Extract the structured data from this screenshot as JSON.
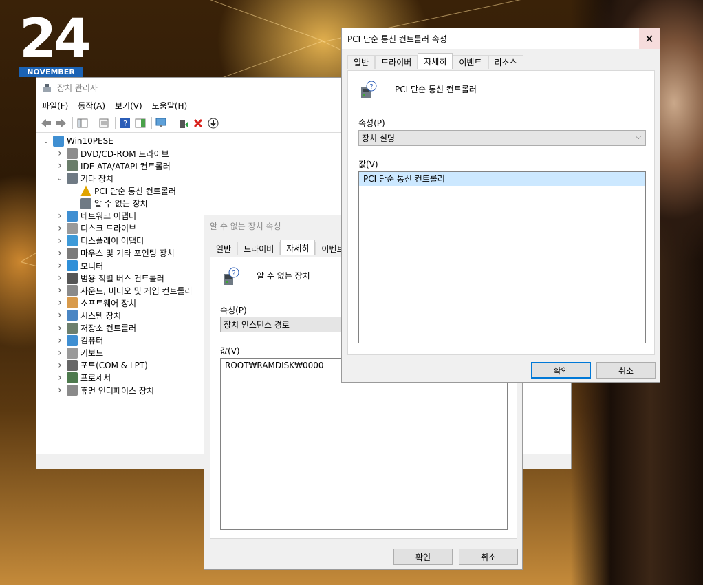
{
  "wallpaper": {
    "date_day": "24",
    "date_month": "NOVEMBER"
  },
  "device_manager": {
    "title": "장치 관리자",
    "menu": [
      "파일(F)",
      "동작(A)",
      "보기(V)",
      "도움말(H)"
    ],
    "tree": [
      {
        "label": "Win10PESE",
        "level": 0,
        "chevron": "v",
        "icon": "computer-icon"
      },
      {
        "label": "DVD/CD-ROM 드라이브",
        "level": 1,
        "chevron": ">",
        "icon": "dvd-drive-icon"
      },
      {
        "label": "IDE ATA/ATAPI 컨트롤러",
        "level": 1,
        "chevron": ">",
        "icon": "ide-controller-icon"
      },
      {
        "label": "기타 장치",
        "level": 1,
        "chevron": "v",
        "icon": "unknown-device-icon"
      },
      {
        "label": "PCI 단순 통신 컨트롤러",
        "level": 2,
        "chevron": "",
        "icon": "warning-device-icon"
      },
      {
        "label": "알 수 없는 장치",
        "level": 2,
        "chevron": "",
        "icon": "unknown-device-icon"
      },
      {
        "label": "네트워크 어댑터",
        "level": 1,
        "chevron": ">",
        "icon": "network-adapter-icon"
      },
      {
        "label": "디스크 드라이브",
        "level": 1,
        "chevron": ">",
        "icon": "disk-drive-icon"
      },
      {
        "label": "디스플레이 어댑터",
        "level": 1,
        "chevron": ">",
        "icon": "display-adapter-icon"
      },
      {
        "label": "마우스 및 기타 포인팅 장치",
        "level": 1,
        "chevron": ">",
        "icon": "mouse-icon"
      },
      {
        "label": "모니터",
        "level": 1,
        "chevron": ">",
        "icon": "monitor-icon"
      },
      {
        "label": "범용 직렬 버스 컨트롤러",
        "level": 1,
        "chevron": ">",
        "icon": "usb-icon"
      },
      {
        "label": "사운드, 비디오 및 게임 컨트롤러",
        "level": 1,
        "chevron": ">",
        "icon": "speaker-icon"
      },
      {
        "label": "소프트웨어 장치",
        "level": 1,
        "chevron": ">",
        "icon": "software-device-icon"
      },
      {
        "label": "시스템 장치",
        "level": 1,
        "chevron": ">",
        "icon": "system-device-icon"
      },
      {
        "label": "저장소 컨트롤러",
        "level": 1,
        "chevron": ">",
        "icon": "storage-controller-icon"
      },
      {
        "label": "컴퓨터",
        "level": 1,
        "chevron": ">",
        "icon": "computer-icon"
      },
      {
        "label": "키보드",
        "level": 1,
        "chevron": ">",
        "icon": "keyboard-icon"
      },
      {
        "label": "포트(COM & LPT)",
        "level": 1,
        "chevron": ">",
        "icon": "port-icon"
      },
      {
        "label": "프로세서",
        "level": 1,
        "chevron": ">",
        "icon": "processor-icon"
      },
      {
        "label": "휴먼 인터페이스 장치",
        "level": 1,
        "chevron": ">",
        "icon": "hid-icon"
      }
    ]
  },
  "unknown_dialog": {
    "title": "알 수 없는 장치 속성",
    "tabs": [
      "일반",
      "드라이버",
      "자세히",
      "이벤트"
    ],
    "active_tab": "자세히",
    "device_name": "알 수 없는 장치",
    "property_label": "속성(P)",
    "property_value": "장치 인스턴스 경로",
    "value_label": "값(V)",
    "values": [
      "ROOT₩RAMDISK₩0000"
    ],
    "ok": "확인",
    "cancel": "취소"
  },
  "pci_dialog": {
    "title": "PCI 단순 통신 컨트롤러 속성",
    "tabs": [
      "일반",
      "드라이버",
      "자세히",
      "이벤트",
      "리소스"
    ],
    "active_tab": "자세히",
    "device_name": "PCI 단순 통신 컨트롤러",
    "property_label": "속성(P)",
    "property_value": "장치 설명",
    "value_label": "값(V)",
    "values": [
      "PCI 단순 통신 컨트롤러"
    ],
    "ok": "확인",
    "cancel": "취소"
  }
}
